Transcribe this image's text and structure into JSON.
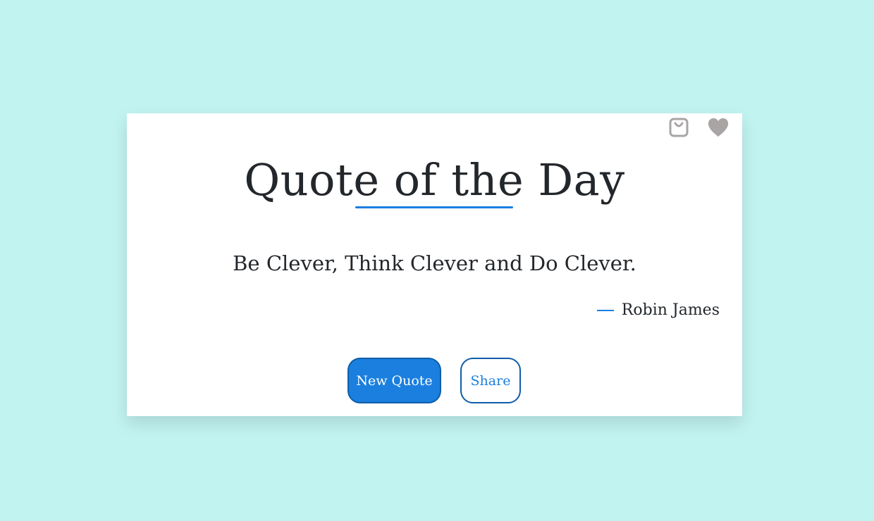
{
  "card": {
    "title": "Quote of the Day",
    "quote": "Be Clever, Think Clever and Do Clever.",
    "author": "Robin James"
  },
  "icons": {
    "bag": "shopping-bag-icon",
    "heart": "heart-icon"
  },
  "buttons": {
    "new_quote": "New Quote",
    "share": "Share"
  },
  "colors": {
    "background": "#c1f3f1",
    "card": "#ffffff",
    "accent": "#1a7fdf",
    "text": "#23272b",
    "icon": "#a9a5a5"
  }
}
